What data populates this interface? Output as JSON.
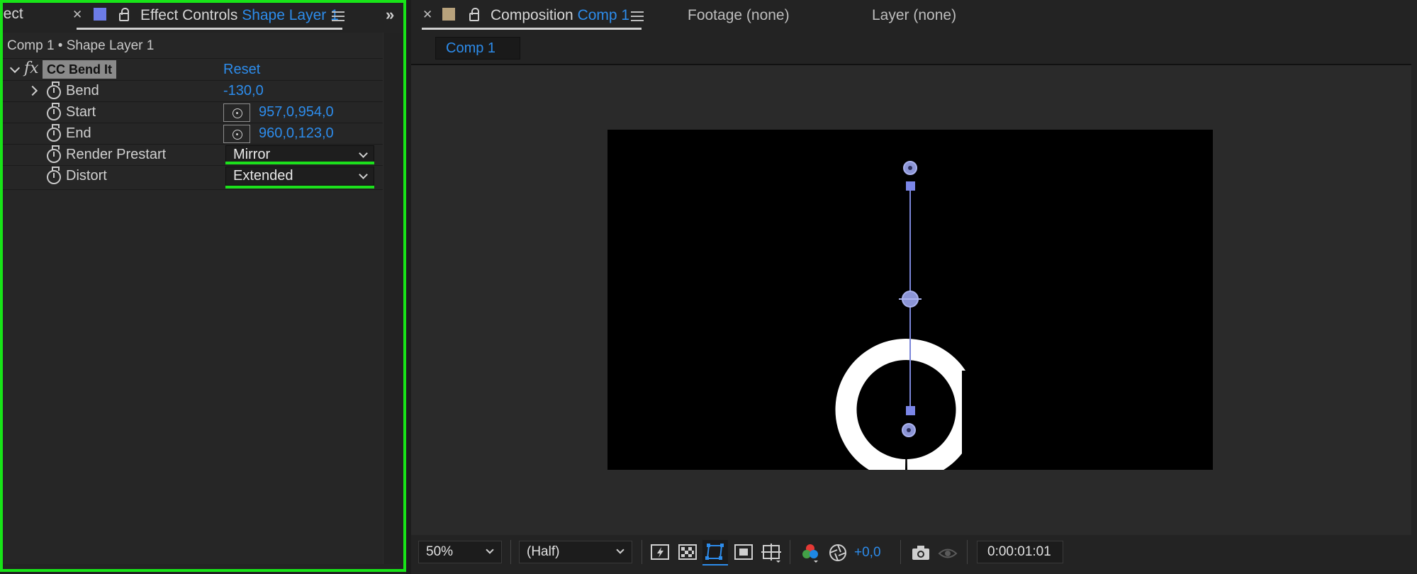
{
  "left_panel": {
    "truncated_tab": "ject",
    "tab_label": "Effect Controls",
    "tab_layer": "Shape Layer 1",
    "layer_path": "Comp 1 • Shape Layer 1",
    "effect": {
      "name": "CC Bend It",
      "reset_label": "Reset",
      "fx_label": "fx"
    },
    "properties": [
      {
        "label": "Bend",
        "value": "-130,0"
      },
      {
        "label": "Start",
        "value": "957,0,954,0"
      },
      {
        "label": "End",
        "value": "960,0,123,0"
      },
      {
        "label": "Render Prestart",
        "value": "Mirror"
      },
      {
        "label": "Distort",
        "value": "Extended"
      }
    ]
  },
  "right_panel": {
    "tabs": {
      "composition_label": "Composition",
      "composition_name": "Comp 1",
      "footage": "Footage (none)",
      "layer": "Layer (none)"
    },
    "sub_tab": "Comp 1",
    "toolbar": {
      "zoom": "50%",
      "resolution": "(Half)",
      "exposure": "+0,0",
      "timecode": "0:00:01:01"
    }
  },
  "colors": {
    "accent_blue": "#2d8ceb",
    "highlight_green": "#18e418",
    "swatch_effect": "#6c7ce8",
    "swatch_comp": "#b8a27c"
  },
  "icons": [
    "close-icon",
    "lock-icon",
    "menu-icon",
    "expand-panels-icon",
    "stopwatch-icon",
    "point-target-icon",
    "chevron-down-icon",
    "camera-icon",
    "color-channels-icon"
  ]
}
